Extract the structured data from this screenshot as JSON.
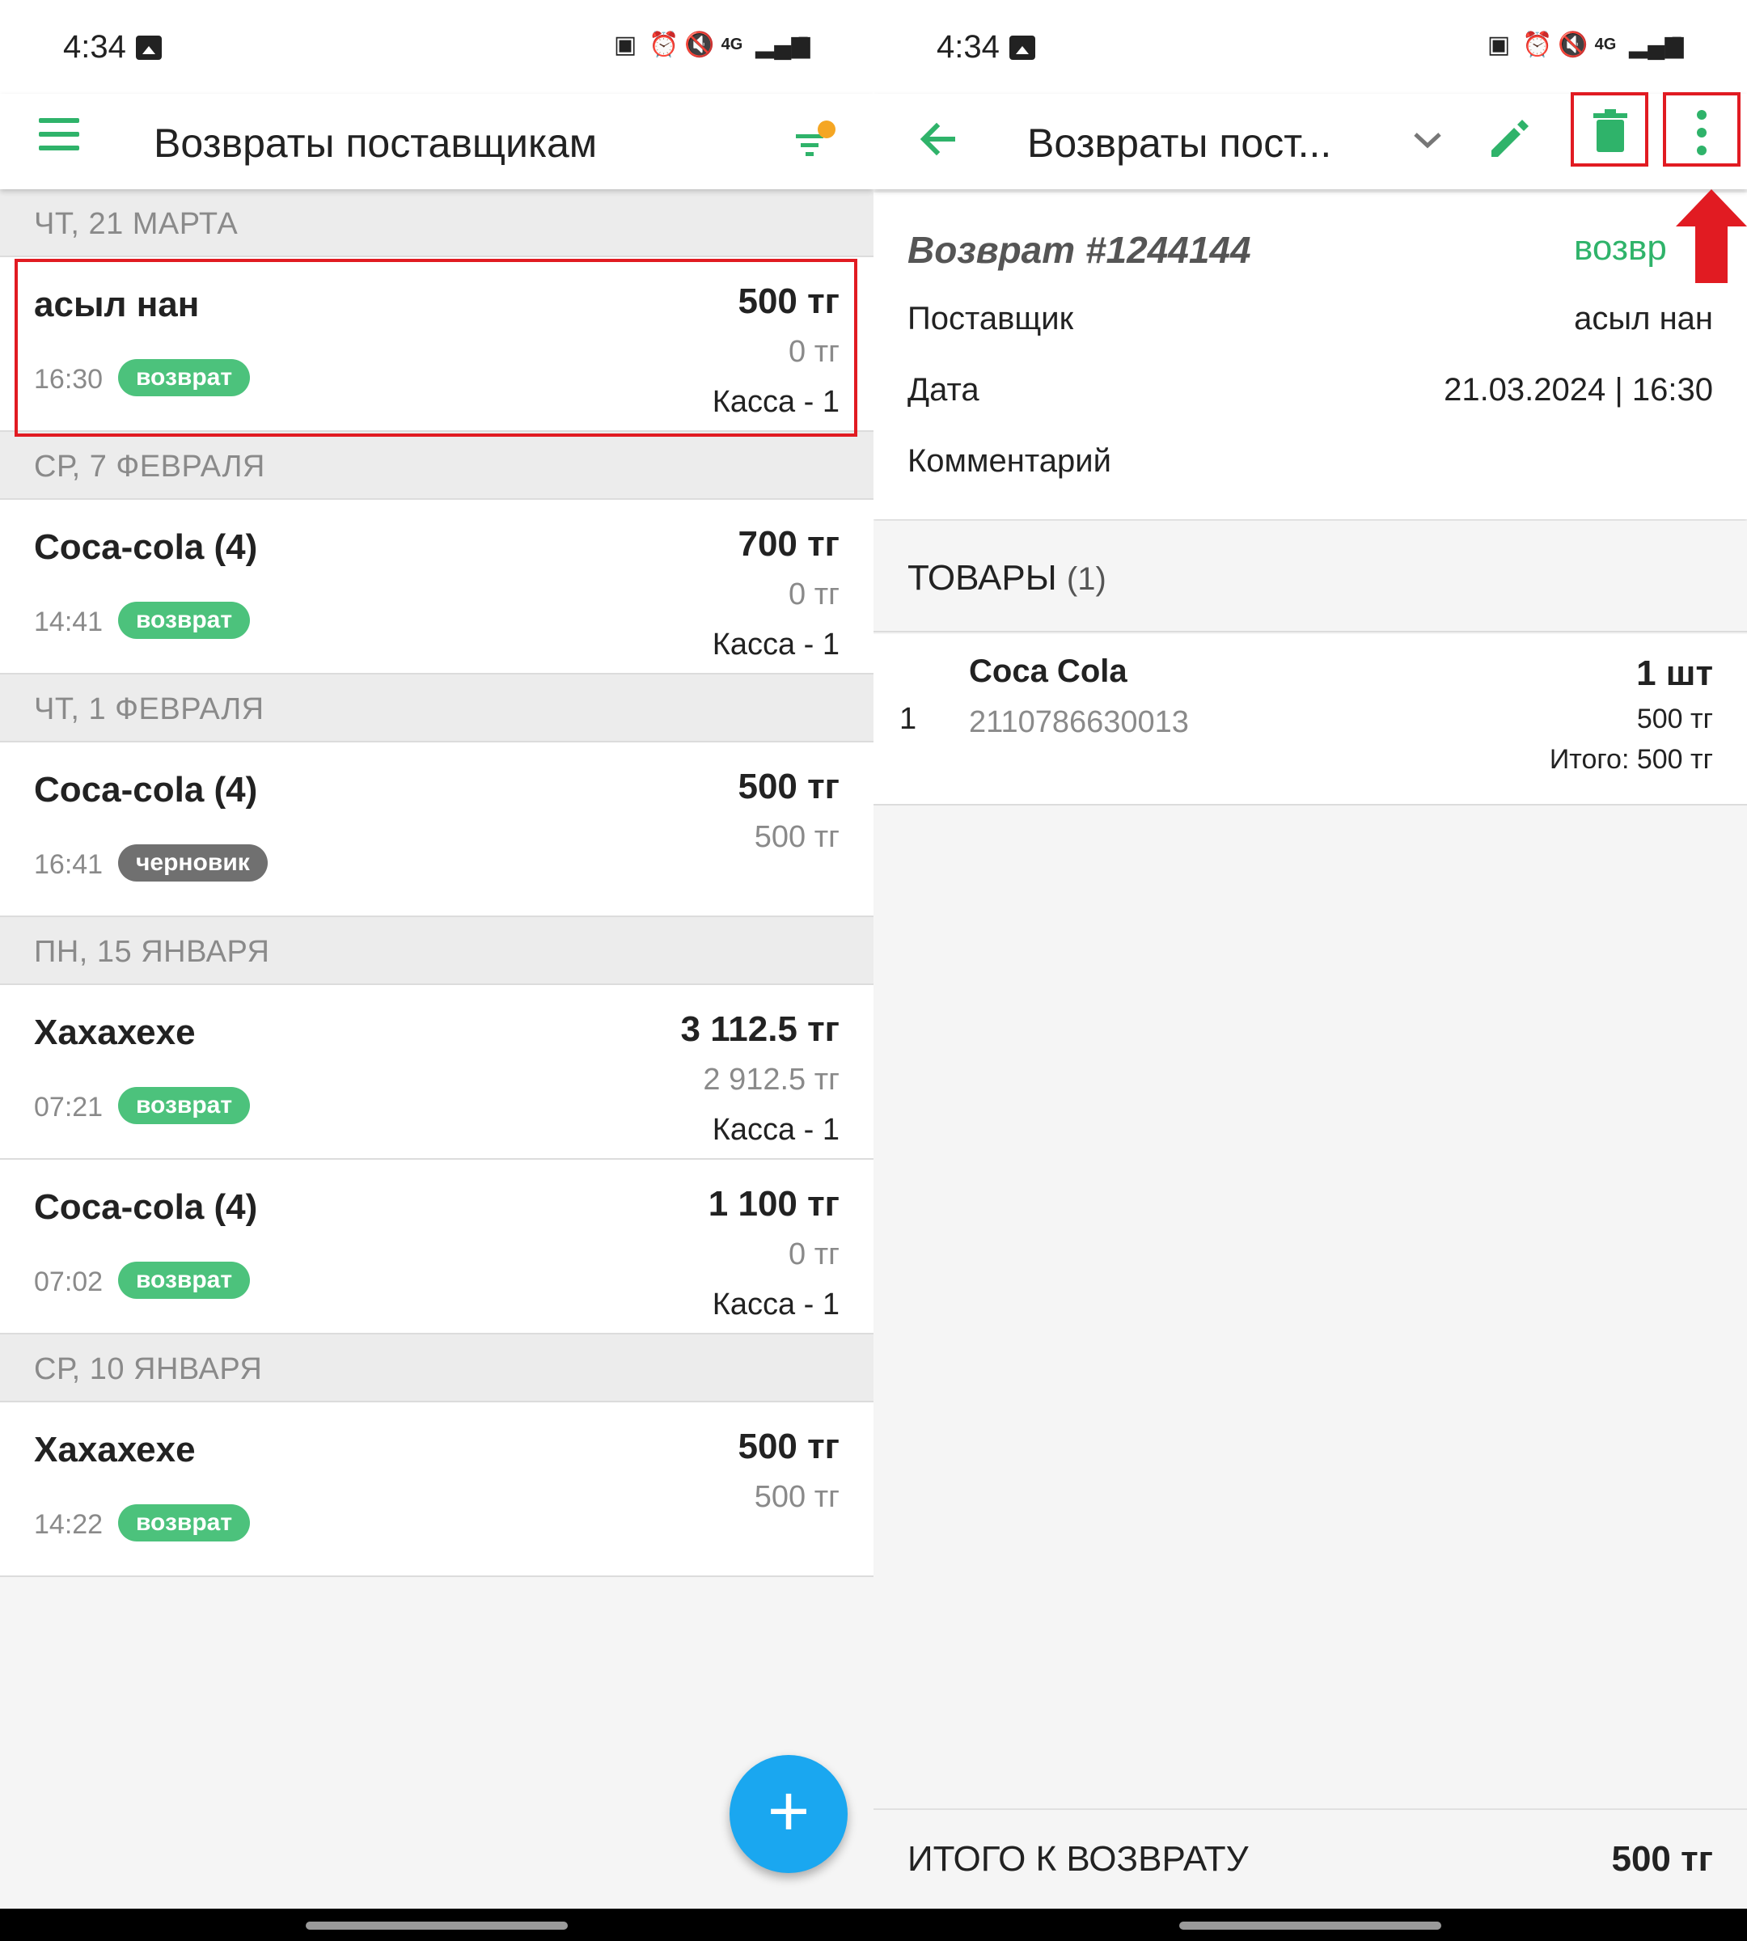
{
  "status_bar": {
    "time": "4:34",
    "icons": [
      "image-icon",
      "battery-saver-icon",
      "alarm-icon",
      "mute-icon",
      "4g-icon",
      "signal-icon",
      "battery-icon"
    ]
  },
  "colors": {
    "accent_green": "#2fb36a",
    "badge_green": "#4cc27c",
    "badge_grey": "#707070",
    "fab_blue": "#1aa7f0",
    "highlight_red": "#e11b22",
    "filter_dot": "#f5a623"
  },
  "left": {
    "title": "Возвраты поставщикам",
    "groups": [
      {
        "date": "ЧТ, 21 МАРТА",
        "rows": [
          {
            "name": "асыл нан",
            "time": "16:30",
            "badge": "возврат",
            "badge_color": "green",
            "sum": "500 тг",
            "paid": "0 тг",
            "cash": "Касса - 1"
          }
        ]
      },
      {
        "date": "СР, 7 ФЕВРАЛЯ",
        "rows": [
          {
            "name": "Coca-cola (4)",
            "time": "14:41",
            "badge": "возврат",
            "badge_color": "green",
            "sum": "700 тг",
            "paid": "0 тг",
            "cash": "Касса - 1"
          }
        ]
      },
      {
        "date": "ЧТ, 1 ФЕВРАЛЯ",
        "rows": [
          {
            "name": "Coca-cola (4)",
            "time": "16:41",
            "badge": "черновик",
            "badge_color": "grey",
            "sum": "500 тг",
            "paid": "500 тг",
            "cash": ""
          }
        ]
      },
      {
        "date": "ПН, 15 ЯНВАРЯ",
        "rows": [
          {
            "name": "Xахахеxе",
            "time": "07:21",
            "badge": "возврат",
            "badge_color": "green",
            "sum": "3 112.5 тг",
            "paid": "2 912.5 тг",
            "cash": "Касса - 1"
          },
          {
            "name": "Coca-cola (4)",
            "time": "07:02",
            "badge": "возврат",
            "badge_color": "green",
            "sum": "1 100 тг",
            "paid": "0 тг",
            "cash": "Касса - 1"
          }
        ]
      },
      {
        "date": "СР, 10 ЯНВАРЯ",
        "rows": [
          {
            "name": "Xахахеxе",
            "time": "14:22",
            "badge": "возврат",
            "badge_color": "green",
            "sum": "500 тг",
            "paid": "500 тг",
            "cash": ""
          }
        ]
      }
    ],
    "fab_label": "+"
  },
  "right": {
    "title": "Возвраты пост...",
    "return_title": "Возврат #1244144",
    "return_status": "возвр",
    "fields": [
      {
        "label": "Поставщик",
        "value": "асыл нан"
      },
      {
        "label": "Дата",
        "value": "21.03.2024 | 16:30"
      },
      {
        "label": "Комментарий",
        "value": ""
      }
    ],
    "goods_header": "ТОВАРЫ",
    "goods_count": "(1)",
    "goods": [
      {
        "index": "1",
        "name": "Coca Cola",
        "code": "2110786630013",
        "qty": "1 шт",
        "price": "500 тг",
        "total": "Итого: 500 тг"
      }
    ],
    "footer_label": "ИТОГО К ВОЗВРАТУ",
    "footer_value": "500 тг"
  }
}
